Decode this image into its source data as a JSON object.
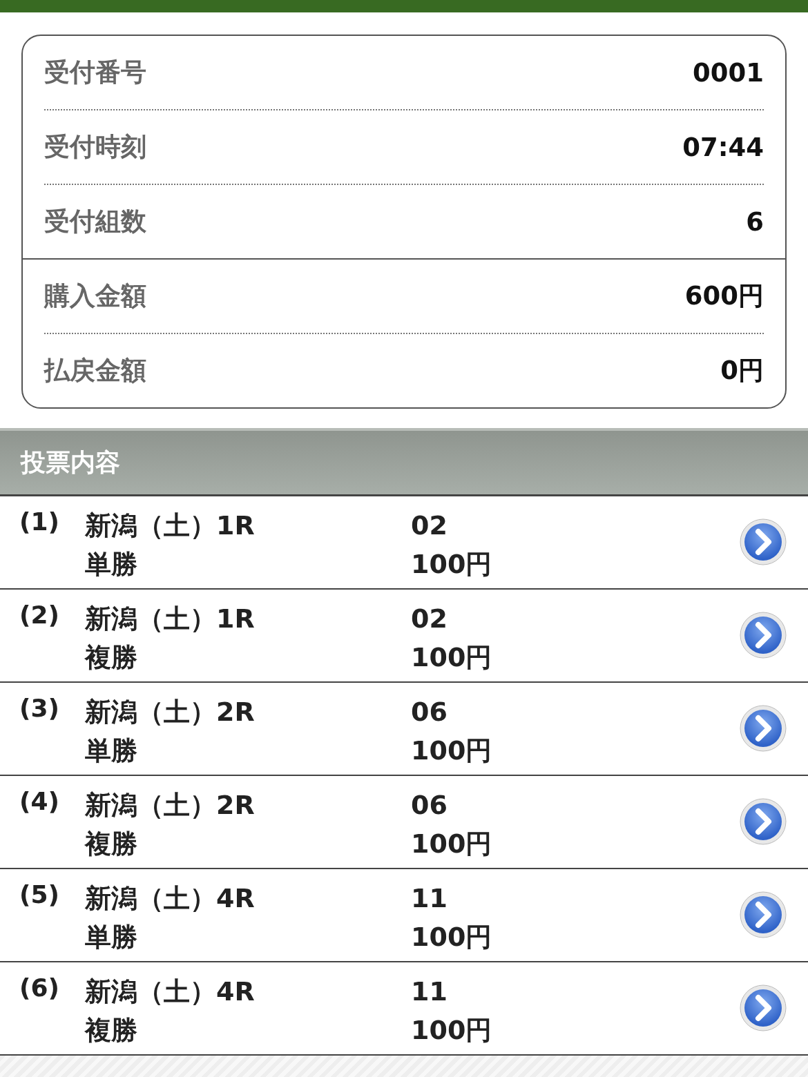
{
  "summary": {
    "groups": [
      [
        {
          "label": "受付番号",
          "value": "0001"
        },
        {
          "label": "受付時刻",
          "value": "07:44"
        },
        {
          "label": "受付組数",
          "value": "6"
        }
      ],
      [
        {
          "label": "購入金額",
          "value": "600円"
        },
        {
          "label": "払戻金額",
          "value": "0円"
        }
      ]
    ]
  },
  "section": {
    "title": "投票内容"
  },
  "bets": [
    {
      "index": "(1)",
      "race": "新潟（土）1R",
      "type": "単勝",
      "number": "02",
      "amount": "100円"
    },
    {
      "index": "(2)",
      "race": "新潟（土）1R",
      "type": "複勝",
      "number": "02",
      "amount": "100円"
    },
    {
      "index": "(3)",
      "race": "新潟（土）2R",
      "type": "単勝",
      "number": "06",
      "amount": "100円"
    },
    {
      "index": "(4)",
      "race": "新潟（土）2R",
      "type": "複勝",
      "number": "06",
      "amount": "100円"
    },
    {
      "index": "(5)",
      "race": "新潟（土）4R",
      "type": "単勝",
      "number": "11",
      "amount": "100円"
    },
    {
      "index": "(6)",
      "race": "新潟（土）4R",
      "type": "複勝",
      "number": "11",
      "amount": "100円"
    }
  ]
}
